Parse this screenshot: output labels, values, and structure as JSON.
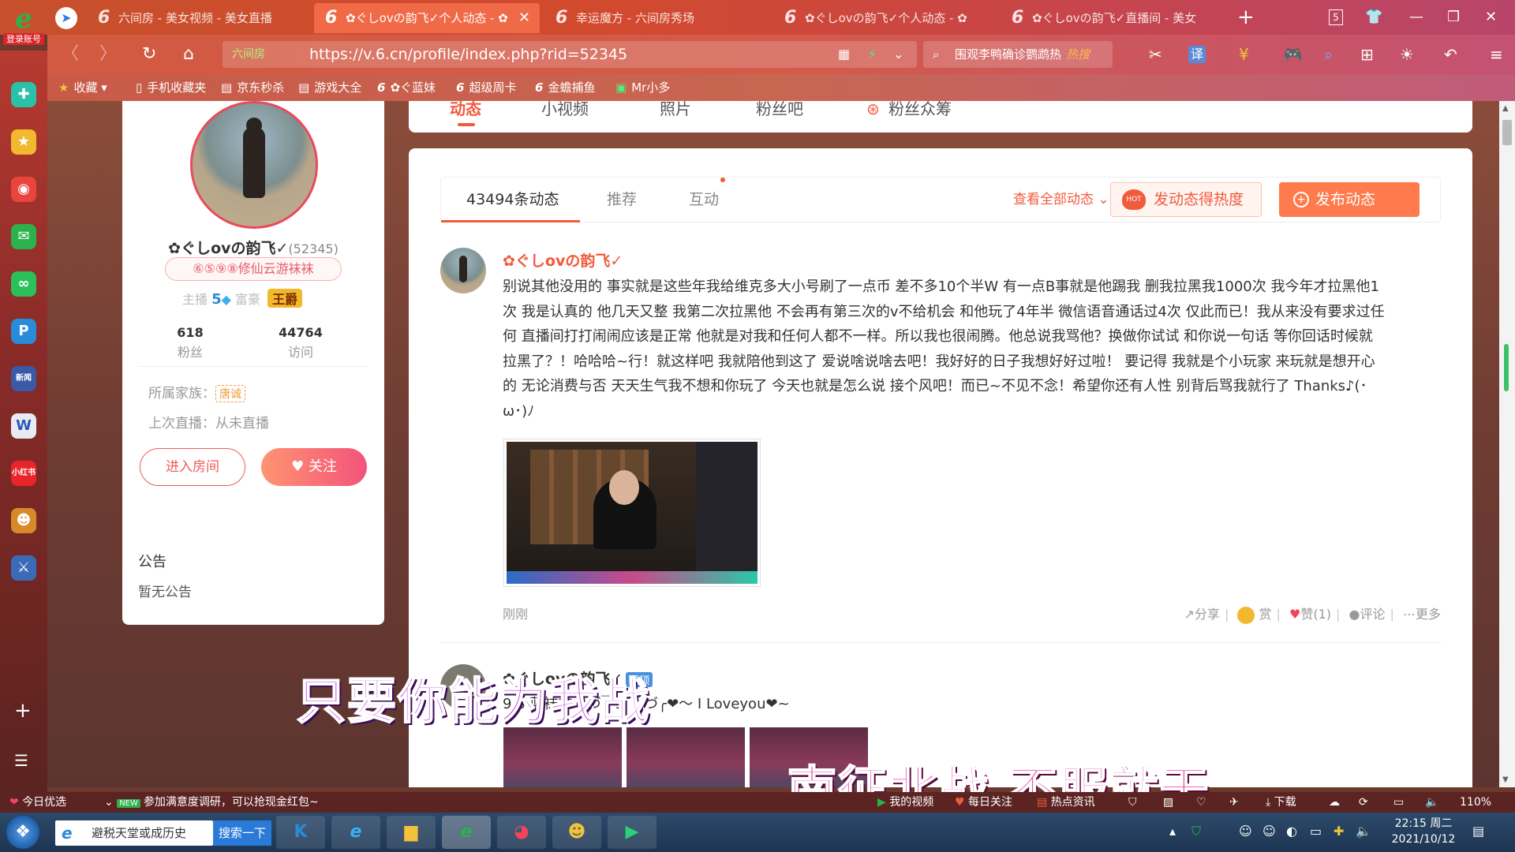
{
  "browser": {
    "login_label": "登录账号",
    "tabs": [
      {
        "title": "六间房 - 美女视频 - 美女直播"
      },
      {
        "title": "✿ぐしovの韵飞✓个人动态 - ✿"
      },
      {
        "title": "幸运魔方 - 六间房秀场"
      },
      {
        "title": "✿ぐしovの韵飞✓个人动态 - ✿"
      },
      {
        "title": "✿ぐしovの韵飞✓直播间 - 美女"
      }
    ],
    "tab_count": "5",
    "address": {
      "site_label": "六间房",
      "url": "https://v.6.cn/profile/index.php?rid=52345"
    },
    "search": {
      "text": "围观李鸭确诊鹦鹉热",
      "hot": "热搜"
    },
    "bookmarks": [
      "收藏",
      "手机收藏夹",
      "京东秒杀",
      "游戏大全",
      "✿ぐ蓝妹",
      "超级周卡",
      "金蟾捕鱼",
      "Mr小多"
    ]
  },
  "profile_nav": [
    "动态",
    "小视频",
    "照片",
    "粉丝吧",
    "粉丝众筹"
  ],
  "profile": {
    "name": "✿ぐしovの韵飞✓",
    "rid": "(52345)",
    "medal": "⑥⑤⑨⑧修仙云游袜袜",
    "rank_label": "主播",
    "rank_level": "5",
    "rich_label": "富豪",
    "rich_title": "王爵",
    "fans_count": "618",
    "fans_label": "粉丝",
    "visits_count": "44764",
    "visits_label": "访问",
    "family_label": "所属家族：",
    "family_name": "唐诚",
    "last_live": "上次直播：从未直播",
    "enter_room": "进入房间",
    "follow": "关注"
  },
  "notice": {
    "title": "公告",
    "content": "暂无公告"
  },
  "feed": {
    "tabs": [
      "43494条动态",
      "推荐",
      "互动"
    ],
    "view_all": "查看全部动态",
    "heat_button": "发动态得热度",
    "heat_badge": "HOT",
    "post_button": "发布动态",
    "post1": {
      "author": "✿ぐしovの韵飞✓",
      "text": "别说其他没用的 事实就是这些年我给维克多大小号刷了一点币 差不多10个半W 有一点B事就是他踢我 删我拉黑我1000次 我今年才拉黑他1次 我是认真的 他几天又整 我第二次拉黑他 不会再有第三次的v不给机会 和他玩了4年半 微信语音通话过4次 仅此而已！我从来没有要求过任何 直播间打打闹闹应该是正常 他就是对我和任何人都不一样。所以我也很闹腾。他总说我骂他？换做你试试 和你说一句话 等你回话时候就拉黑了？！哈哈哈~行！就这样吧 我就陪他到这了 爱说啥说啥去吧！我好好的日子我想好好过啦！ 要记得 我就是个小玩家 来玩就是想开心的 无论消费与否 天天生气我不想和你玩了 今天也就是怎么说 接个风吧！而已~不见不念！希望你还有人性 别背后骂我就行了 Thanks♪(･ω･)ﾉ",
      "time": "刚刚",
      "share": "分享",
      "reward": "赏",
      "like": "赞(1)",
      "comment": "评论",
      "more": "更多"
    },
    "post2": {
      "author": "✿ぐしovの韵飞✓",
      "pin": "置顶",
      "text": "9 8 蓝袜袜 ( づ￣3￣)づ╭❤～ I Loveyou❤~"
    }
  },
  "subtitles": {
    "line1": "只要你能为我战",
    "line2": "南征北战  不服就干"
  },
  "statusbar": {
    "daily": "今日优选",
    "new_badge": "NEW",
    "survey": "参加满意度调研，可以抢现金红包~",
    "my_video": "我的视频",
    "daily_follow": "每日关注",
    "hot_news": "热点资讯",
    "download": "下载",
    "zoom": "110%"
  },
  "taskbar": {
    "ie_search": "避税天堂或成历史",
    "search_btn": "搜索一下",
    "time": "22:15 周二",
    "date": "2021/10/12"
  }
}
